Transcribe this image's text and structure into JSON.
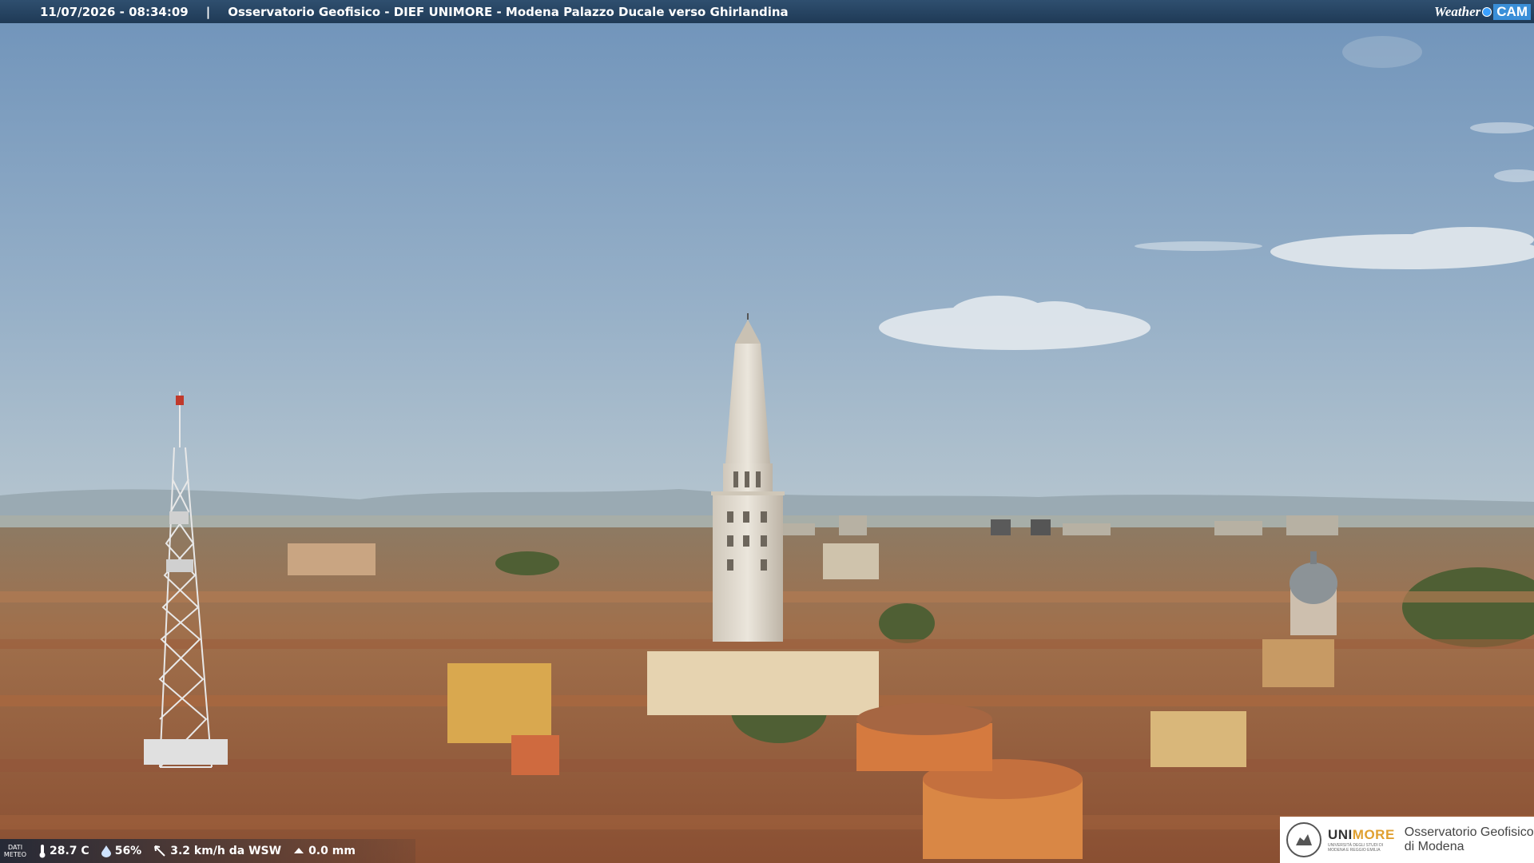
{
  "header": {
    "datetime": "11/07/2026 - 08:34:09",
    "separator": "|",
    "location": "Osservatorio Geofisico - DIEF UNIMORE - Modena Palazzo Ducale verso Ghirlandina"
  },
  "brand": {
    "weather": "Weather",
    "cam": "CAM"
  },
  "meteo": {
    "label_line1": "DATI",
    "label_line2": "METEO",
    "temperature": "28.7 C",
    "humidity": "56%",
    "wind": "3.2 km/h da WSW",
    "rain": "0.0 mm"
  },
  "institution": {
    "name_uni": "UNI",
    "name_more": "MORE",
    "sub_line1": "UNIVERSITÀ DEGLI STUDI DI",
    "sub_line2": "MODENA E REGGIO EMILIA",
    "observatory_line1": "Osservatorio Geofisico",
    "observatory_line2": "di Modena"
  },
  "colors": {
    "sky_top": "#7598bd",
    "sky_bottom": "#a9bfcf",
    "roof": "#a9643f",
    "tower": "#e6e0d5"
  }
}
